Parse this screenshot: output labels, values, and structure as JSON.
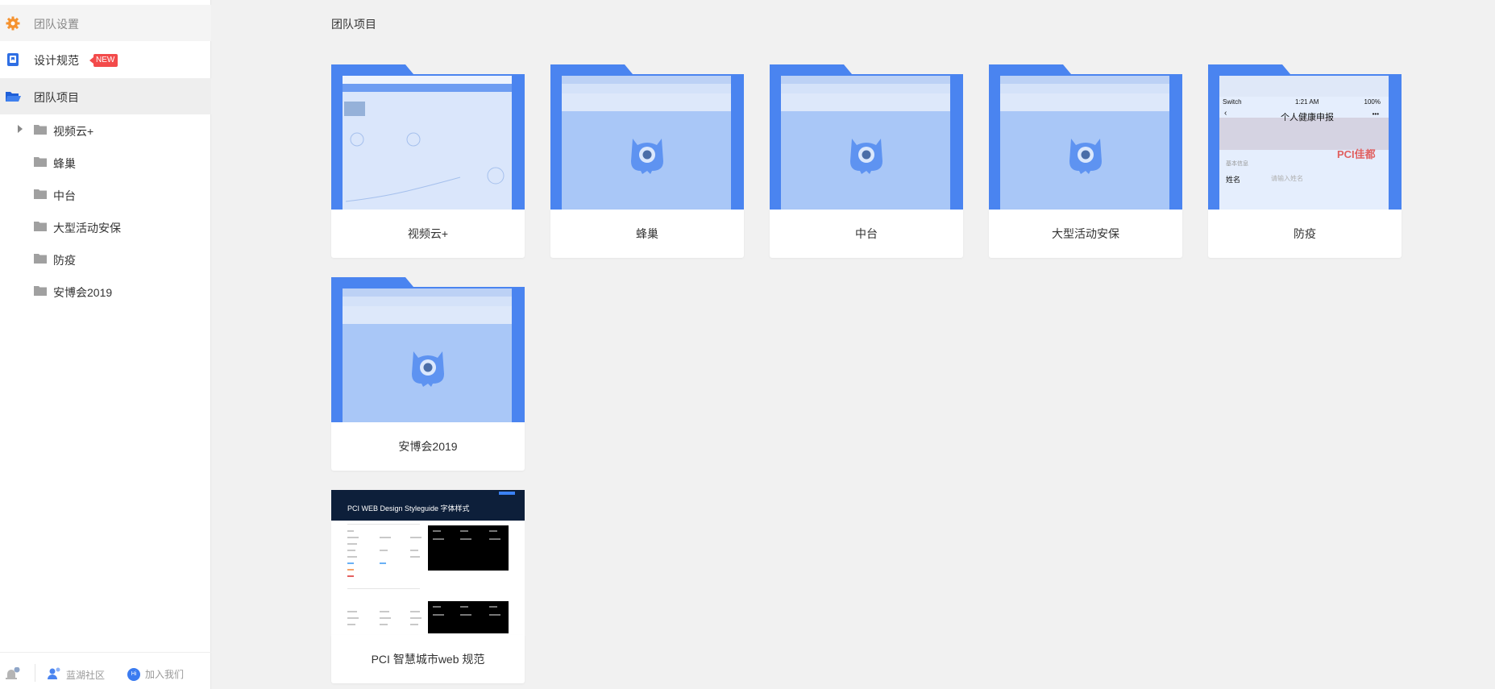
{
  "sidebar": {
    "settings_label": "团队设置",
    "design_label": "设计规范",
    "design_badge": "NEW",
    "team_label": "团队项目",
    "tree": [
      {
        "label": "视频云+"
      },
      {
        "label": "蜂巢"
      },
      {
        "label": "中台"
      },
      {
        "label": "大型活动安保"
      },
      {
        "label": "防疫"
      },
      {
        "label": "安博会2019"
      }
    ],
    "footer": {
      "community_label": "蓝湖社区",
      "join_label": "加入我们",
      "join_icon_text": "Hi"
    }
  },
  "main": {
    "title": "团队项目",
    "projects": [
      {
        "name": "视频云+",
        "thumb": "dashboard"
      },
      {
        "name": "蜂巢",
        "thumb": "mascot"
      },
      {
        "name": "中台",
        "thumb": "mascot"
      },
      {
        "name": "大型活动安保",
        "thumb": "mascot"
      },
      {
        "name": "防疫",
        "thumb": "mobile-form"
      },
      {
        "name": "安博会2019",
        "thumb": "mascot"
      },
      {
        "name": "PCI 智慧城市web 规范",
        "thumb": "styleguide"
      }
    ],
    "fangyi_preview": {
      "carrier": "Switch",
      "time": "1:21 AM",
      "battery": "100%",
      "page_title": "个人健康申报",
      "brand": "PCI佳都",
      "section": "基本信息",
      "field_label": "姓名",
      "field_placeholder": "请输入姓名"
    },
    "styleguide_preview": {
      "header": "PCI WEB Design Styleguide   字体样式"
    }
  },
  "colors": {
    "folder_blue": "#4a84f0",
    "folder_light": "#a9c7f7",
    "badge_red": "#f34b4b",
    "settings_orange": "#f5922f"
  }
}
